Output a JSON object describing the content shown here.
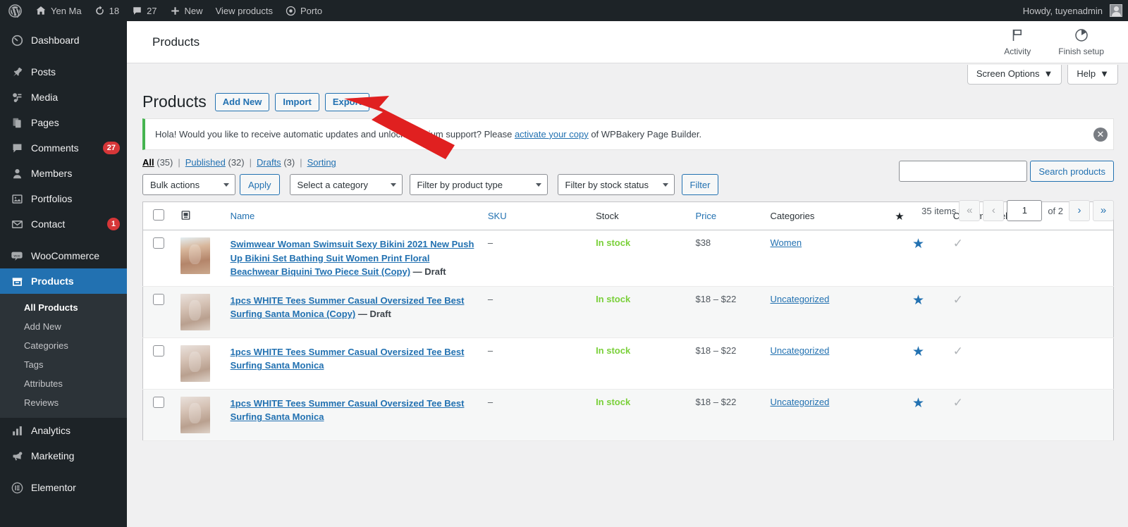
{
  "adminbar": {
    "logo_icon": "wordpress-icon",
    "items": [
      {
        "label": "Yen Ma",
        "icon": "home-icon"
      },
      {
        "label": "18",
        "icon": "updates-icon"
      },
      {
        "label": "27",
        "icon": "comment-icon"
      },
      {
        "label": "New",
        "icon": "plus-icon"
      },
      {
        "label": "View products",
        "icon": ""
      },
      {
        "label": "Porto",
        "icon": "porto-icon"
      }
    ],
    "howdy": "Howdy, tuyenadmin"
  },
  "sidebar": {
    "items": [
      {
        "label": "Dashboard",
        "icon": "dashboard-icon",
        "count": "",
        "current": false
      },
      {
        "label": "Posts",
        "icon": "pin-icon",
        "count": "",
        "current": false
      },
      {
        "label": "Media",
        "icon": "media-icon",
        "count": "",
        "current": false
      },
      {
        "label": "Pages",
        "icon": "pages-icon",
        "count": "",
        "current": false
      },
      {
        "label": "Comments",
        "icon": "comment-icon",
        "count": "27",
        "current": false
      },
      {
        "label": "Members",
        "icon": "user-icon",
        "count": "",
        "current": false
      },
      {
        "label": "Portfolios",
        "icon": "portfolio-icon",
        "count": "",
        "current": false
      },
      {
        "label": "Contact",
        "icon": "envelope-icon",
        "count": "1",
        "current": false
      },
      {
        "label": "WooCommerce",
        "icon": "woo-icon",
        "count": "",
        "current": false
      },
      {
        "label": "Products",
        "icon": "products-icon",
        "count": "",
        "current": true
      },
      {
        "label": "Analytics",
        "icon": "analytics-icon",
        "count": "",
        "current": false
      },
      {
        "label": "Marketing",
        "icon": "megaphone-icon",
        "count": "",
        "current": false
      },
      {
        "label": "Elementor",
        "icon": "elementor-icon",
        "count": "",
        "current": false
      }
    ],
    "submenu": [
      {
        "label": "All Products",
        "current": true
      },
      {
        "label": "Add New",
        "current": false
      },
      {
        "label": "Categories",
        "current": false
      },
      {
        "label": "Tags",
        "current": false
      },
      {
        "label": "Attributes",
        "current": false
      },
      {
        "label": "Reviews",
        "current": false
      }
    ]
  },
  "wc_header": {
    "title": "Products",
    "activity_label": "Activity",
    "activity_icon": "flag-icon",
    "finish_setup_label": "Finish setup",
    "finish_setup_icon": "pie-progress-icon"
  },
  "screen_meta": {
    "screen_options": "Screen Options",
    "help": "Help"
  },
  "page": {
    "title": "Products",
    "actions": [
      {
        "label": "Add New",
        "name": "add-new-button"
      },
      {
        "label": "Import",
        "name": "import-button"
      },
      {
        "label": "Export",
        "name": "export-button"
      }
    ]
  },
  "notice": {
    "text_before": "Hola! Would you like to receive automatic updates and unlock premium support? Please ",
    "link": "activate your copy",
    "text_after": " of WPBakery Page Builder.",
    "dismiss_icon": "close-icon"
  },
  "views": [
    {
      "label": "All",
      "count": "(35)",
      "current": true
    },
    {
      "label": "Published",
      "count": "(32)",
      "current": false
    },
    {
      "label": "Drafts",
      "count": "(3)",
      "current": false
    },
    {
      "label": "Sorting",
      "count": "",
      "current": false
    }
  ],
  "tablenav": {
    "bulk_actions": "Bulk actions",
    "apply": "Apply",
    "select_category": "Select a category",
    "filter_product_type": "Filter by product type",
    "filter_stock_status": "Filter by stock status",
    "filter": "Filter",
    "items_count": "35 items",
    "current_page": "1",
    "total_pages": "of 2",
    "first_label": "«",
    "prev_label": "‹",
    "next_label": "›",
    "last_label": "»"
  },
  "search": {
    "value": "",
    "placeholder": "",
    "button": "Search products"
  },
  "table": {
    "columns": [
      {
        "label": "",
        "name": "select-all-checkbox"
      },
      {
        "label": "",
        "name": "image-column-icon"
      },
      {
        "label": "Name",
        "name": "column-name"
      },
      {
        "label": "SKU",
        "name": "column-sku"
      },
      {
        "label": "Stock",
        "name": "column-stock"
      },
      {
        "label": "Price",
        "name": "column-price"
      },
      {
        "label": "Categories",
        "name": "column-categories"
      },
      {
        "label": "",
        "name": "column-featured-star"
      },
      {
        "label": "Custom Sidebars",
        "name": "column-custom-sidebars"
      }
    ],
    "rows": [
      {
        "name": "Swimwear Woman Swimsuit Sexy Bikini 2021 New Push Up Bikini Set Bathing Suit Women Print Floral Beachwear Biquini Two Piece Suit (Copy)",
        "state": "— Draft",
        "sku": "–",
        "stock": "In stock",
        "price": "$38",
        "categories": "Women",
        "featured": "★",
        "sidebar_check": "✓"
      },
      {
        "name": "1pcs WHITE Tees Summer Casual Oversized Tee Best Surfing Santa Monica (Copy)",
        "state": "— Draft",
        "sku": "–",
        "stock": "In stock",
        "price": "$18 – $22",
        "categories": "Uncategorized",
        "featured": "★",
        "sidebar_check": "✓"
      },
      {
        "name": "1pcs WHITE Tees Summer Casual Oversized Tee Best Surfing Santa Monica",
        "state": "",
        "sku": "–",
        "stock": "In stock",
        "price": "$18 – $22",
        "categories": "Uncategorized",
        "featured": "★",
        "sidebar_check": "✓"
      },
      {
        "name": "1pcs WHITE Tees Summer Casual Oversized Tee Best Surfing Santa Monica",
        "state": "",
        "sku": "–",
        "stock": "In stock",
        "price": "$18 – $22",
        "categories": "Uncategorized",
        "featured": "★",
        "sidebar_check": "✓"
      }
    ]
  },
  "annotation": {
    "arrow_icon": "red-arrow-pointer",
    "color": "#e02020"
  }
}
